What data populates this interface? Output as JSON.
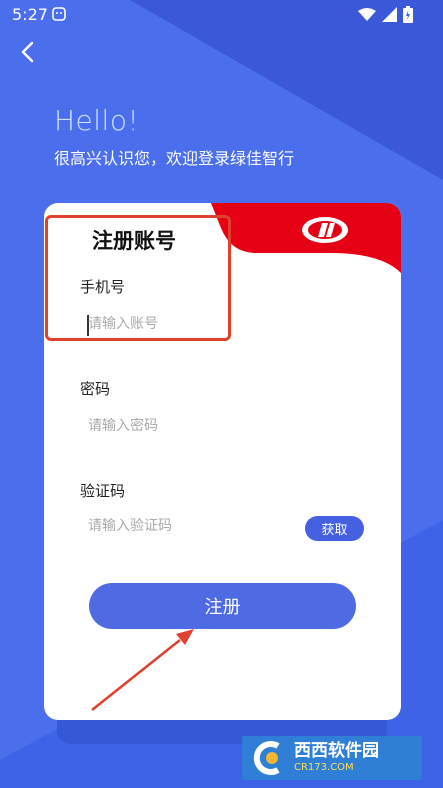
{
  "status_bar": {
    "time": "5:27",
    "icons": [
      "notification-icon",
      "wifi-icon",
      "signal-icon",
      "battery-icon"
    ]
  },
  "header": {
    "back_icon": "chevron-left-icon",
    "hello": "Hello!",
    "welcome": "很高兴认识您，欢迎登录绿佳智行"
  },
  "card": {
    "title": "注册账号",
    "phone_label": "手机号",
    "phone_placeholder": "请输入账号",
    "password_label": "密码",
    "password_placeholder": "请输入密码",
    "code_label": "验证码",
    "code_placeholder": "请输入验证码",
    "get_code_button": "获取",
    "register_button": "注册"
  },
  "watermark": {
    "title": "西西软件园",
    "domain": "CR173.COM"
  },
  "colors": {
    "background": "#3f63e6",
    "accent_red": "#e50014",
    "button_blue": "#4e6be4",
    "highlight": "#e0412f"
  }
}
